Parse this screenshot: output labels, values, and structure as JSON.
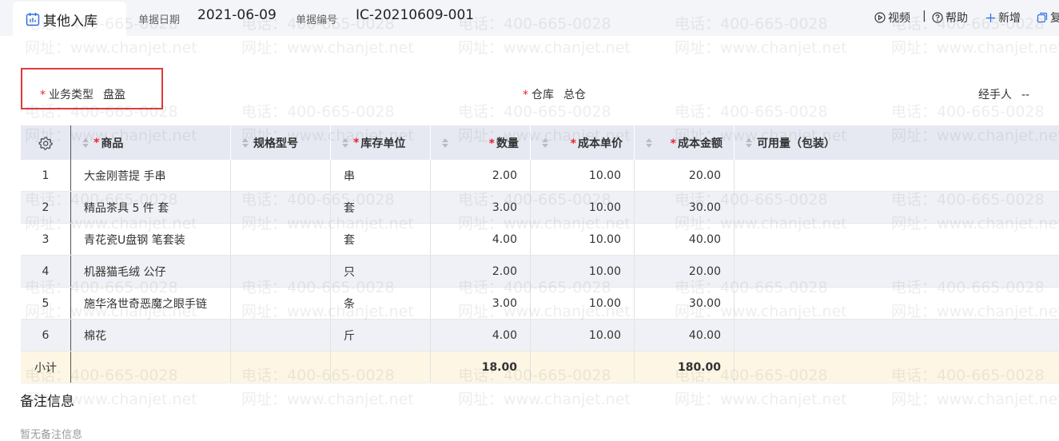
{
  "header": {
    "tab_title": "其他入库",
    "date_label": "单据日期",
    "date_value": "2021-06-09",
    "number_label": "单据编号",
    "number_value": "IC-20210609-001",
    "tools": {
      "video": "视频",
      "separator": "|",
      "help": "帮助",
      "add": "新增",
      "copy": "复"
    }
  },
  "form": {
    "business_type_label": "业务类型",
    "business_type_value": "盘盈",
    "warehouse_label": "仓库",
    "warehouse_value": "总仓",
    "handler_label": "经手人",
    "handler_value": "--",
    "required_mark": "*"
  },
  "table": {
    "columns": [
      "商品",
      "规格型号",
      "库存单位",
      "数量",
      "成本单价",
      "成本金额",
      "可用量（包装）"
    ],
    "rows": [
      {
        "no": "1",
        "product": "大金刚菩提 手串",
        "spec": "",
        "unit": "串",
        "qty": "2.00",
        "price": "10.00",
        "amount": "20.00",
        "available": ""
      },
      {
        "no": "2",
        "product": "精品茶具 5 件 套",
        "spec": "",
        "unit": "套",
        "qty": "3.00",
        "price": "10.00",
        "amount": "30.00",
        "available": ""
      },
      {
        "no": "3",
        "product": "青花瓷U盘钢 笔套装",
        "spec": "",
        "unit": "套",
        "qty": "4.00",
        "price": "10.00",
        "amount": "40.00",
        "available": ""
      },
      {
        "no": "4",
        "product": "机器猫毛绒 公仔",
        "spec": "",
        "unit": "只",
        "qty": "2.00",
        "price": "10.00",
        "amount": "20.00",
        "available": ""
      },
      {
        "no": "5",
        "product": "施华洛世奇恶魔之眼手链",
        "spec": "",
        "unit": "条",
        "qty": "3.00",
        "price": "10.00",
        "amount": "30.00",
        "available": ""
      },
      {
        "no": "6",
        "product": "棉花",
        "spec": "",
        "unit": "斤",
        "qty": "4.00",
        "price": "10.00",
        "amount": "40.00",
        "available": ""
      }
    ],
    "subtotal": {
      "label": "小计",
      "qty": "18.00",
      "amount": "180.00"
    }
  },
  "remarks": {
    "title": "备注信息",
    "empty_text": "暂无备注信息"
  },
  "watermark": {
    "phone": "电话：400-665-0028",
    "site": "网址：www.chanjet.net"
  },
  "colors": {
    "required": "#ee2233",
    "highlight": "#e03a3a",
    "accent": "#2f6fe0"
  }
}
